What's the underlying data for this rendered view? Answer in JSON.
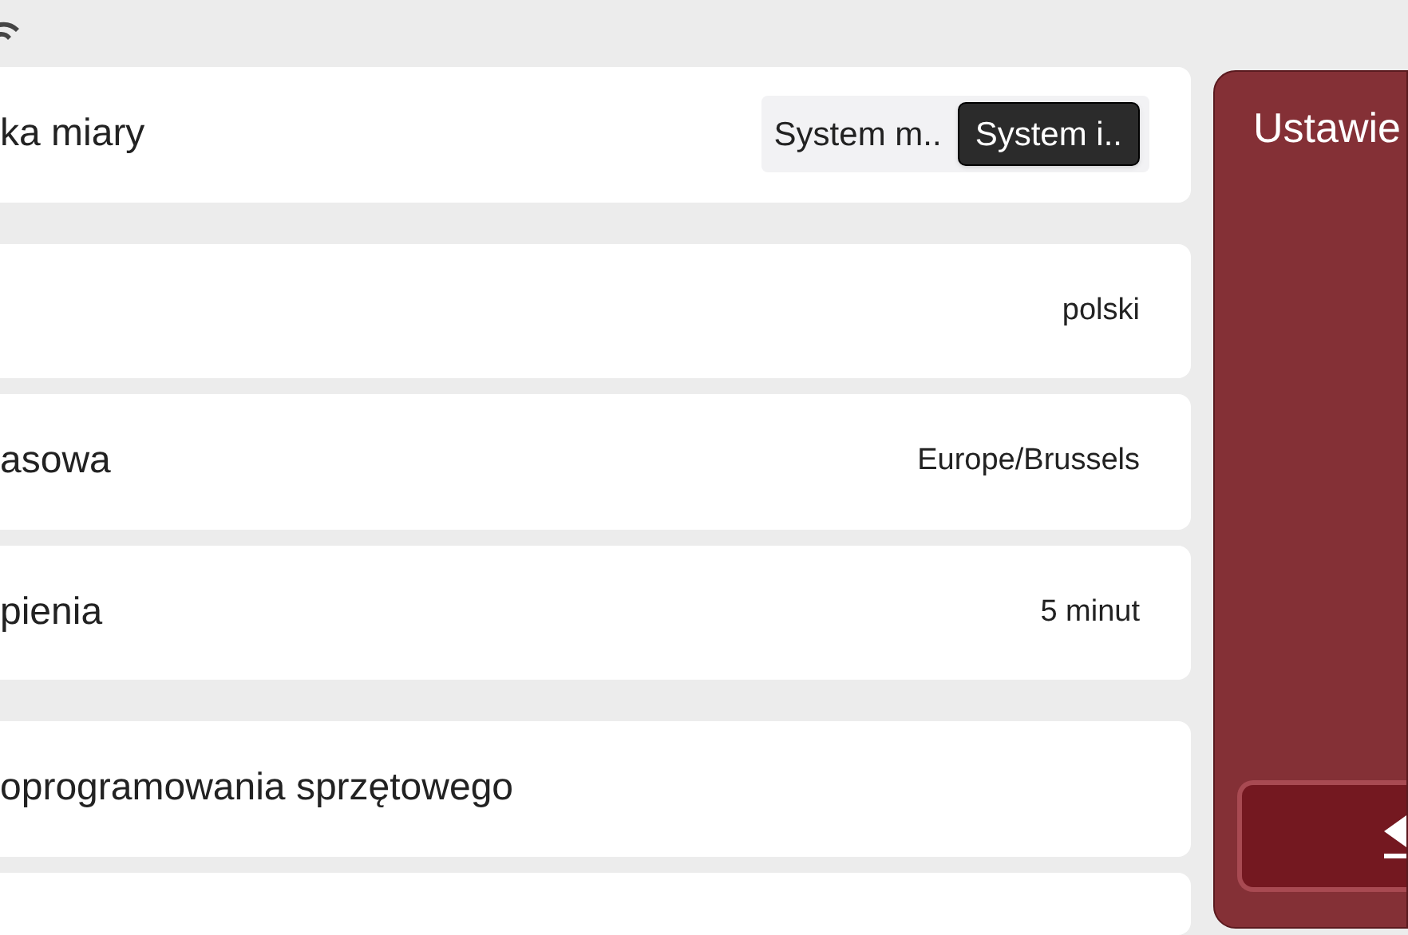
{
  "settings": [
    {
      "kind": "toggle",
      "label": "ka miary",
      "options": [
        {
          "label": "System m..",
          "selected": false
        },
        {
          "label": "System i..",
          "selected": true
        }
      ]
    },
    {
      "kind": "value",
      "value": "polski"
    },
    {
      "kind": "value",
      "label": "asowa",
      "value": "Europe/Brussels"
    },
    {
      "kind": "value",
      "label": "pienia",
      "value": "5 minut"
    },
    {
      "kind": "value",
      "label": "oprogramowania sprzętowego"
    }
  ],
  "side_panel": {
    "title": "Ustawie"
  }
}
